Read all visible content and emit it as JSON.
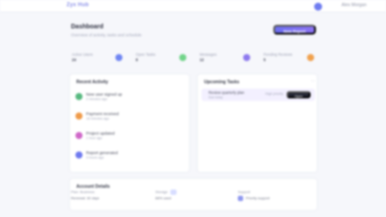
{
  "app": {
    "logo": "Zyx Hub",
    "user_name": "Alex Morgan"
  },
  "header": {
    "title": "Dashboard",
    "subtitle": "Overview of activity, tasks and schedule",
    "primary_button": "New Report"
  },
  "stats": [
    {
      "label": "Active Users",
      "value": "24",
      "accent": "#6f85f2"
    },
    {
      "label": "Open Tasks",
      "value": "8",
      "accent": "#72d48a"
    },
    {
      "label": "Messages",
      "value": "12",
      "accent": "#8d79ee"
    },
    {
      "label": "Pending Reviews",
      "value": "5",
      "accent": "#f0a14e"
    }
  ],
  "activity_card": {
    "title": "Recent Activity",
    "items": [
      {
        "title": "New user signed up",
        "sub": "2 minutes ago",
        "accent": "#58b980"
      },
      {
        "title": "Payment received",
        "sub": "18 minutes ago",
        "accent": "#ef9a49"
      },
      {
        "title": "Project updated",
        "sub": "1 hour ago",
        "accent": "#cf67c8"
      },
      {
        "title": "Report generated",
        "sub": "3 hours ago",
        "accent": "#6e79ef"
      }
    ]
  },
  "tasks_card": {
    "title": "Upcoming Tasks",
    "menu_label": "⋯",
    "task": {
      "title": "Review quarterly plan",
      "sub": "Due today",
      "note": "High priority",
      "action": "Open"
    }
  },
  "bottom": {
    "title": "Account Details",
    "col1_line1": "Plan: Business",
    "col1_line2": "Renewal: 30 days",
    "col2_line1": "Storage",
    "col2_line2": "68% used",
    "col3_line1": "Support",
    "col3_line2": "Priority support"
  }
}
